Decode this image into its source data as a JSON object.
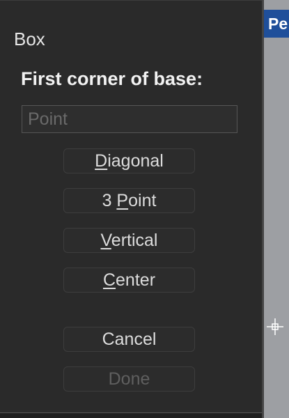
{
  "dialog": {
    "title": "Box",
    "prompt": "First corner of base:",
    "input": {
      "placeholder": "Point",
      "value": ""
    },
    "options": [
      {
        "mnemonic": "D",
        "rest": "iagonal",
        "full": "Diagonal"
      },
      {
        "prefix": "3 ",
        "mnemonic": "P",
        "rest": "oint",
        "full": "3 Point"
      },
      {
        "mnemonic": "V",
        "rest": "ertical",
        "full": "Vertical"
      },
      {
        "mnemonic": "C",
        "rest": "enter",
        "full": "Center"
      }
    ],
    "cancel_label": "Cancel",
    "done_label": "Done"
  },
  "viewport": {
    "tab_label": "Pe",
    "tab_color": "#1f4f9a",
    "background_color": "#9d9fa3",
    "cursor_icon": "crosshair-cursor-icon"
  }
}
